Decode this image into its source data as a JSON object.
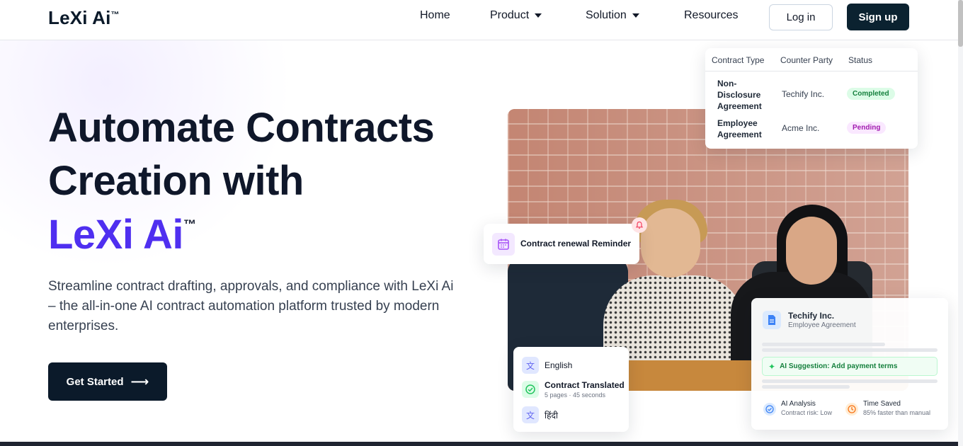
{
  "nav": {
    "logo": "LeXi Ai",
    "logo_tm": "™",
    "links": [
      {
        "label": "Home"
      },
      {
        "label": "Product"
      },
      {
        "label": "Solution"
      },
      {
        "label": "Resources"
      }
    ],
    "login": "Log in",
    "signup": "Sign up"
  },
  "hero": {
    "line1": "Automate Contracts",
    "line2": "Creation with",
    "brand": "LeXi Ai",
    "brand_tm": "™",
    "subtitle": "Streamline contract drafting, approvals, and compliance with LeXi Ai – the all-in-one AI contract automation platform trusted by modern enterprises.",
    "cta": "Get Started",
    "cta_arrow": "⟶"
  },
  "contracts_table": {
    "headers": [
      "Contract Type",
      "Counter Party",
      "Status"
    ],
    "rows": [
      {
        "type": "Non-Disclosure Agreement",
        "type_lines": [
          "Non-",
          "Disclosure",
          "Agreement"
        ],
        "party": "Techify Inc.",
        "status": "Completed"
      },
      {
        "type": "Employee Agreement",
        "type_lines": [
          "Employee",
          "Agreement"
        ],
        "party": "Acme Inc.",
        "status": "Pending"
      }
    ]
  },
  "reminder": {
    "label": "Contract renewal Reminder",
    "icon": "calendar-icon"
  },
  "translation": {
    "source_lang": "English",
    "status": "Contract Translated",
    "meta": "5 pages · 45 seconds",
    "target_lang": "हिंदी"
  },
  "ai_card": {
    "company": "Techify Inc.",
    "doc_type": "Employee Agreement",
    "suggestion": "AI Suggestion: Add payment terms",
    "analysis_title": "AI Analysis",
    "analysis_value": "Contract risk: Low",
    "time_title": "Time Saved",
    "time_value": "85% faster than manual"
  },
  "colors": {
    "brand_purple": "#4f2ff0",
    "dark_navy": "#0b1a2a",
    "completed_green": "#15803d",
    "pending_magenta": "#a21caf"
  }
}
